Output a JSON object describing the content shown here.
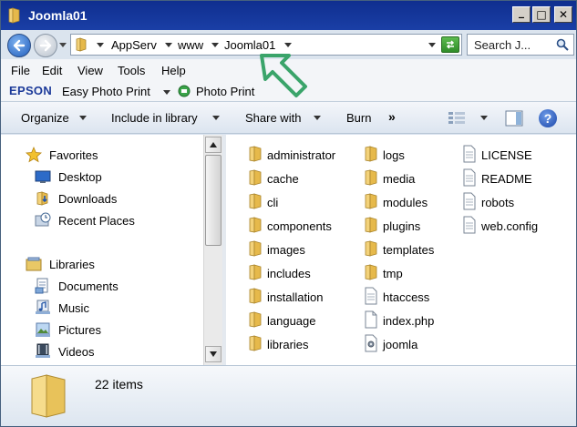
{
  "window": {
    "title": "Joomla01",
    "caption_buttons": {
      "minimize": "_",
      "maximize": "□",
      "close": "✕"
    }
  },
  "address": {
    "crumbs": [
      "AppServ",
      "www",
      "Joomla01"
    ]
  },
  "search": {
    "placeholder": "Search J..."
  },
  "menu": [
    "File",
    "Edit",
    "View",
    "Tools",
    "Help"
  ],
  "epson": {
    "logo": "EPSON",
    "easy_photo_print": "Easy Photo Print",
    "photo_print": "Photo Print"
  },
  "commands": {
    "organize": "Organize",
    "include_in_library": "Include in library",
    "share_with": "Share with",
    "burn": "Burn",
    "more": "»",
    "help": "?"
  },
  "navigation": {
    "favorites": {
      "label": "Favorites",
      "items": [
        "Desktop",
        "Downloads",
        "Recent Places"
      ]
    },
    "libraries": {
      "label": "Libraries",
      "items": [
        "Documents",
        "Music",
        "Pictures",
        "Videos"
      ]
    }
  },
  "files": {
    "column1": [
      "administrator",
      "cache",
      "cli",
      "components",
      "images",
      "includes",
      "installation",
      "language",
      "libraries"
    ],
    "column2_folders": [
      "logs",
      "media",
      "modules",
      "plugins",
      "templates",
      "tmp"
    ],
    "column2_files": [
      "htaccess",
      "index.php",
      "joomla"
    ],
    "column3": [
      "LICENSE",
      "README",
      "robots",
      "web.config"
    ]
  },
  "details": {
    "item_count": "22 items"
  },
  "colors": {
    "title_bar": "#0f2e8f",
    "epson_blue": "#1c3a99",
    "annotation_green": "#3aa46a",
    "folder_yellow": "#e8c25a"
  }
}
